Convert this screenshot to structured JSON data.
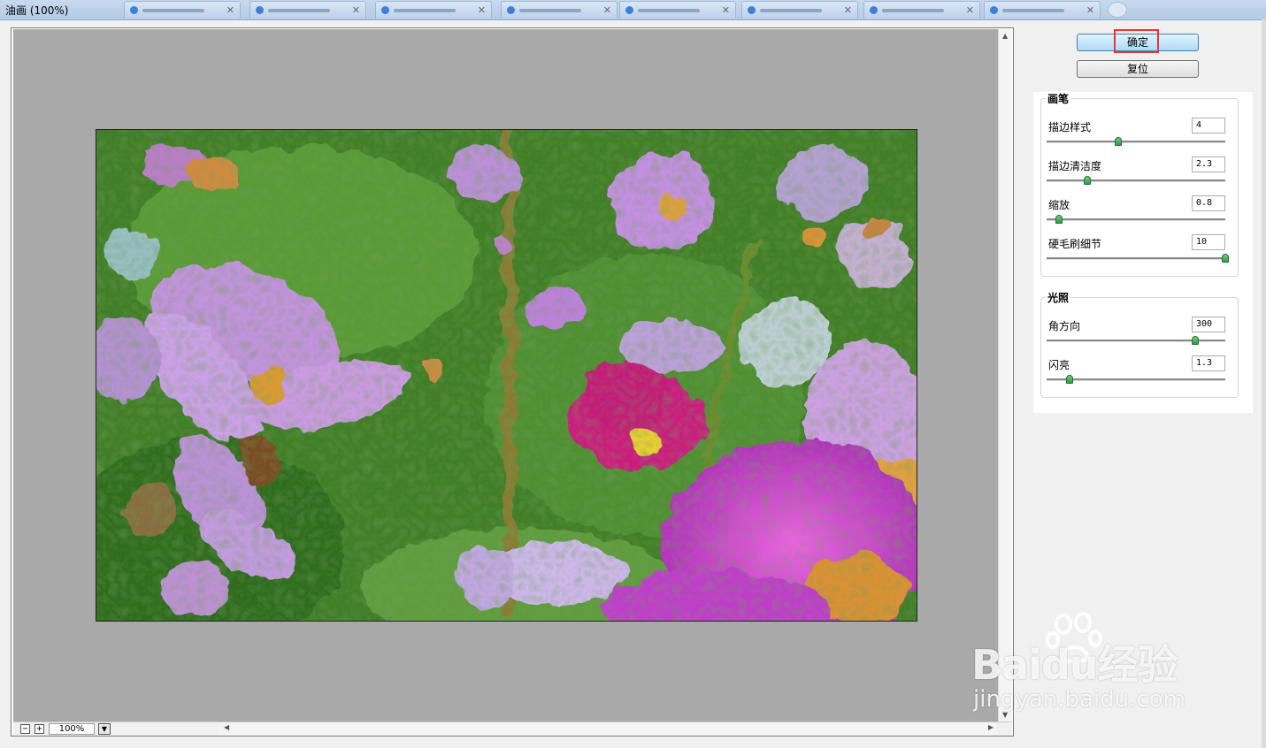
{
  "window": {
    "title": "油画 (100%)"
  },
  "buttons": {
    "ok_label": "确定",
    "reset_label": "复位"
  },
  "brush": {
    "title": "画笔",
    "params": [
      {
        "label": "描边样式",
        "value": "4",
        "level": 0.4
      },
      {
        "label": "描边清洁度",
        "value": "2.3",
        "level": 0.23
      },
      {
        "label": "缩放",
        "value": "0.8",
        "level": 0.07
      },
      {
        "label": "硬毛刷细节",
        "value": "10",
        "level": 1.0
      }
    ]
  },
  "lighting": {
    "title": "光照",
    "params": [
      {
        "label": "角方向",
        "value": "300",
        "level": 0.83
      },
      {
        "label": "闪亮",
        "value": "1.3",
        "level": 0.13
      }
    ]
  },
  "zoom": {
    "value": "100%",
    "minus": "−",
    "plus": "+"
  },
  "watermark": {
    "main": "Baidu经验",
    "sub": "jingyan.baidu.com"
  },
  "colors": {
    "ok_highlight": "#e33333",
    "slider_thumb": "#2f9a45",
    "canvas_gray": "#a9a9a9"
  }
}
